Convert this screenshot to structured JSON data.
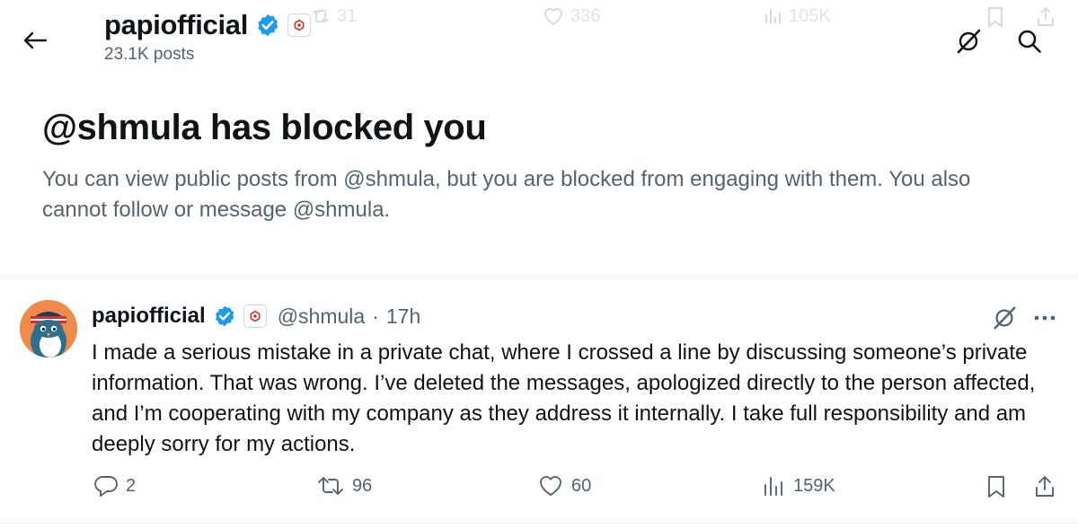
{
  "header": {
    "title": "papiofficial",
    "posts_count": "23.1K posts"
  },
  "ghost_actions": {
    "reposts": "31",
    "likes": "336",
    "views": "105K"
  },
  "blocked_notice": {
    "title": "@shmula has blocked you",
    "body": "You can view public posts from @shmula, but you are blocked from engaging with them. You also cannot follow or message @shmula."
  },
  "post": {
    "name": "papiofficial",
    "handle": "@shmula",
    "separator": "·",
    "time": "17h",
    "text": "I made a serious mistake in a private chat, where I crossed a line by discussing someone’s private information. That was wrong. I’ve deleted the messages, apologized directly to the person affected, and I’m cooperating with my company as they address it internally. I take full responsibility and am deeply sorry for my actions.",
    "replies": "2",
    "reposts": "96",
    "likes": "60",
    "views": "159K"
  },
  "colors": {
    "text": "#0f1419",
    "secondary": "#536471",
    "verified_blue": "#1d9bf0",
    "affiliate_red": "#d0312d",
    "avatar_bg": "#f08a4b"
  }
}
